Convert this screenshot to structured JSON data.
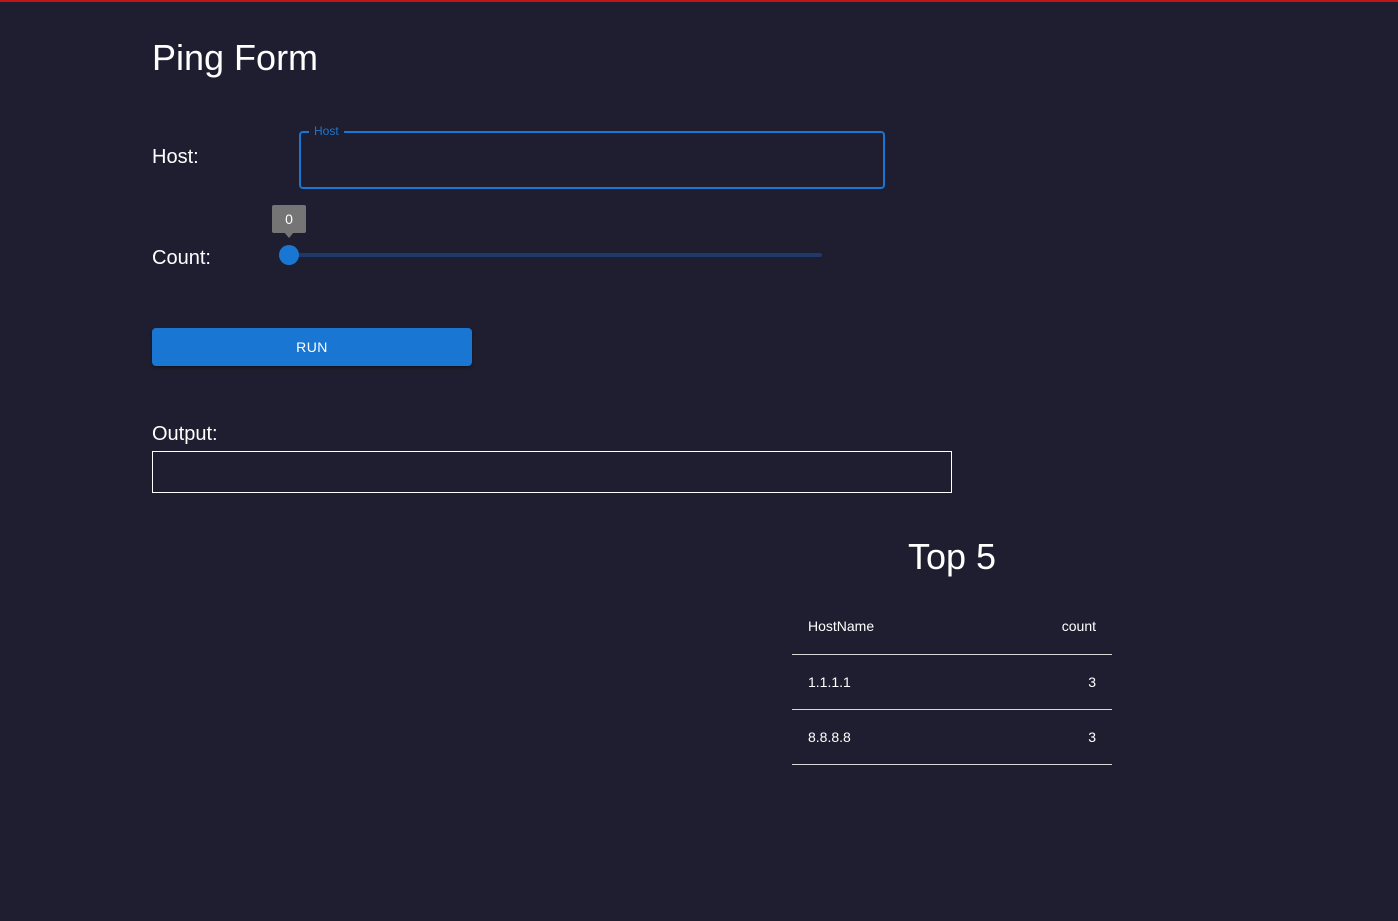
{
  "page": {
    "title": "Ping Form"
  },
  "form": {
    "host_label": "Host:",
    "host_field_legend": "Host",
    "host_value": "",
    "count_label": "Count:",
    "count_value": "0",
    "count_fraction": 0,
    "run_label": "RUN",
    "output_label": "Output:",
    "output_value": ""
  },
  "top": {
    "title": "Top 5",
    "columns": [
      "HostName",
      "count"
    ],
    "rows": [
      {
        "host": "1.1.1.1",
        "count": "3"
      },
      {
        "host": "8.8.8.8",
        "count": "3"
      }
    ]
  },
  "colors": {
    "background": "#1e1e30",
    "accent": "#1976d2",
    "top_line": "#c01418"
  }
}
